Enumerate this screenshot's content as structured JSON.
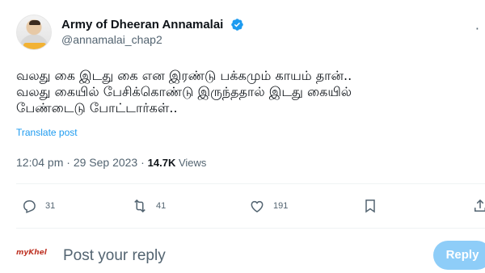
{
  "author": {
    "display_name": "Army of Dheeran Annamalai",
    "handle": "@annamalai_chap2",
    "verified_icon": "verified-badge-icon",
    "accent": "#1d9bf0"
  },
  "tweet": {
    "lines": [
      "வலது கை இடது கை என இரண்டு பக்கமும் காயம் தான்..",
      "வலது கையில் பேசிக்கொண்டு இருந்ததால் இடது கையில்",
      "பேண்டைடு போட்டார்கள்.."
    ],
    "translate_label": "Translate post"
  },
  "meta": {
    "timestamp": "12:04 pm · 29 Sep 2023 · ",
    "views_count": "14.7K",
    "views_label": " Views"
  },
  "actions": {
    "reply": {
      "icon": "reply-icon",
      "count": "31"
    },
    "repost": {
      "icon": "repost-icon",
      "count": "41"
    },
    "like": {
      "icon": "heart-icon",
      "count": "191"
    },
    "bookmark": {
      "icon": "bookmark-icon"
    },
    "share": {
      "icon": "share-icon"
    }
  },
  "reply_bar": {
    "avatar_text": "myKhel",
    "placeholder": "Post your reply",
    "button_label": "Reply",
    "button_color": "#8ecdf8"
  },
  "more_icon": "more-options-icon"
}
